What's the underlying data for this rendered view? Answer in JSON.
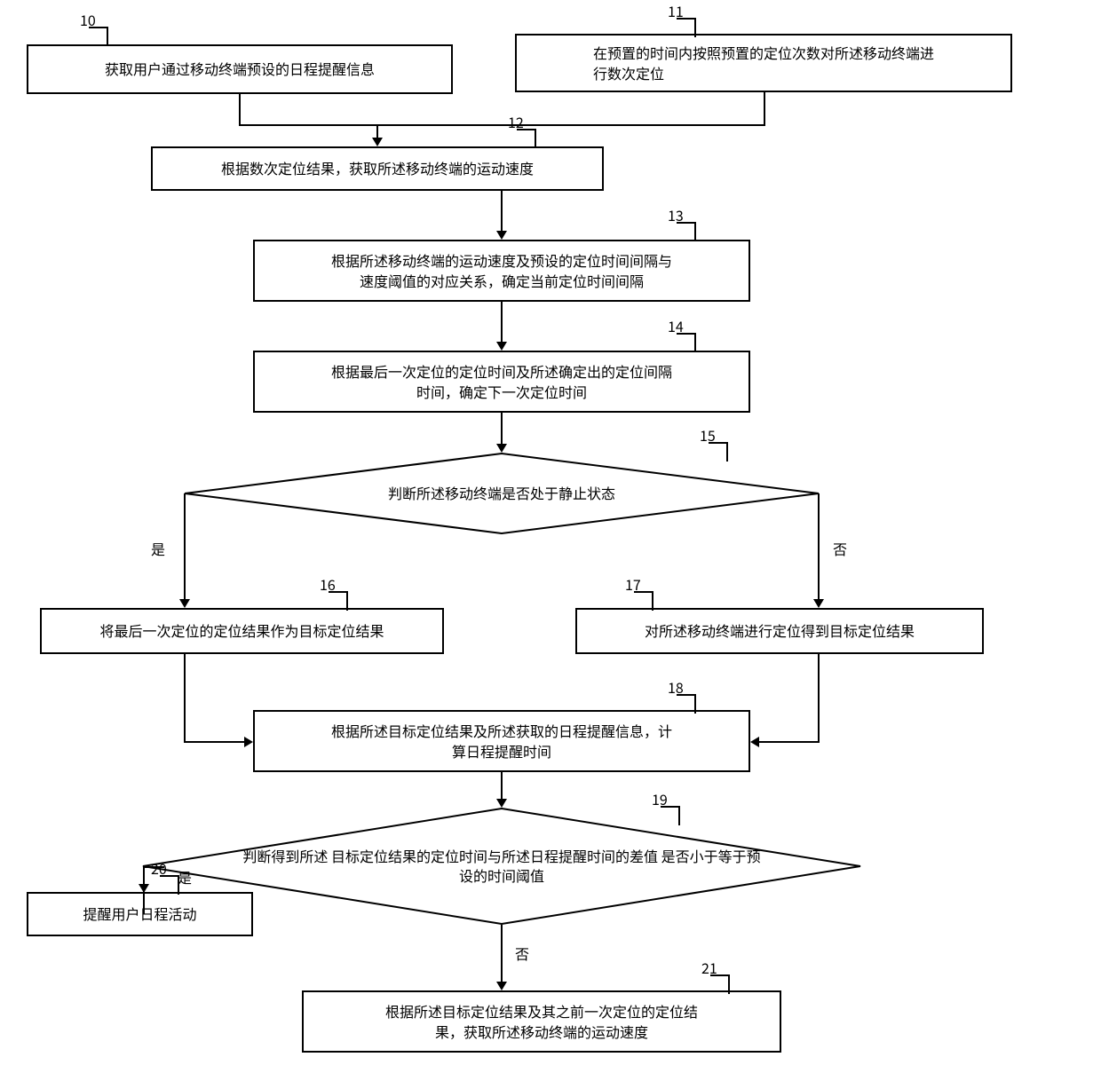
{
  "refs": {
    "n10": "10",
    "n11": "11",
    "n12": "12",
    "n13": "13",
    "n14": "14",
    "n15": "15",
    "n16": "16",
    "n17": "17",
    "n18": "18",
    "n19": "19",
    "n20": "20",
    "n21": "21"
  },
  "labels": {
    "yes": "是",
    "no": "否"
  },
  "nodes": {
    "n10": "获取用户通过移动终端预设的日程提醒信息",
    "n11_l1": "在预置的时间内按照预置的定位次数对所述移动终端进",
    "n11_l2": "行数次定位",
    "n12": "根据数次定位结果，获取所述移动终端的运动速度",
    "n13_l1": "根据所述移动终端的运动速度及预设的定位时间间隔与",
    "n13_l2": "速度阈值的对应关系，确定当前定位时间间隔",
    "n14_l1": "根据最后一次定位的定位时间及所述确定出的定位间隔",
    "n14_l2": "时间，确定下一次定位时间",
    "n15": "判断所述移动终端是否处于静止状态",
    "n16": "将最后一次定位的定位结果作为目标定位结果",
    "n17": "对所述移动终端进行定位得到目标定位结果",
    "n18_l1": "根据所述目标定位结果及所述获取的日程提醒信息，计",
    "n18_l2": "算日程提醒时间",
    "n19_l1": "判断得到所述",
    "n19_l2": "目标定位结果的定位时间与所述日程提醒时间的差值",
    "n19_l3": "是否小于等于预设的时间阈值",
    "n20": "提醒用户日程活动",
    "n21_l1": "根据所述目标定位结果及其之前一次定位的定位结",
    "n21_l2": "果，获取所述移动终端的运动速度"
  }
}
